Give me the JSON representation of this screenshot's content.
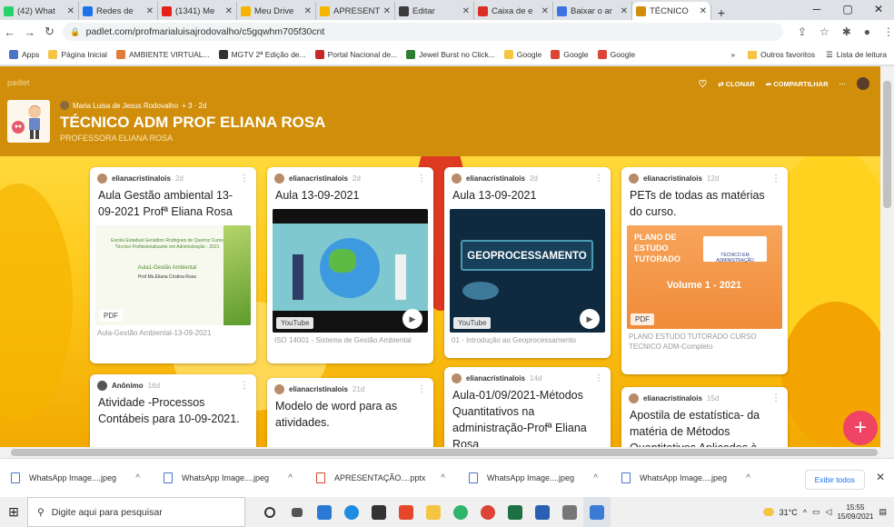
{
  "tabs": [
    {
      "label": "(42) What",
      "color": "#25d366"
    },
    {
      "label": "Redes de",
      "color": "#1a73e8"
    },
    {
      "label": "(1341) Me",
      "color": "#e62117"
    },
    {
      "label": "Meu Drive",
      "color": "#f4b400"
    },
    {
      "label": "APRESENT",
      "color": "#f4b400"
    },
    {
      "label": "Editar",
      "color": "#3c3c3c"
    },
    {
      "label": "Caixa de e",
      "color": "#d93025"
    },
    {
      "label": "Baixar o ar",
      "color": "#3b72e4"
    },
    {
      "label": "TÉCNICO",
      "color": "#d08e0b",
      "active": true
    }
  ],
  "window_controls": {
    "minimize": "─",
    "maximize": "▢",
    "close": "✕"
  },
  "url": "padlet.com/profmarialuisajrodovalho/c5gqwhm705f30cnt",
  "bookmarks": [
    "Apps",
    "Página Inicial",
    "AMBIENTE VIRTUAL...",
    "MGTV 2ª Edição de...",
    "Portal Nacional de...",
    "Jewel Burst no Click...",
    "Google",
    "Google",
    "Google"
  ],
  "bookmarks_right": {
    "more": "»",
    "outros": "Outros favoritos",
    "lista": "Lista de leitura"
  },
  "padlet": {
    "brand": "padlet",
    "author": "Maria Luisa de Jesus Rodovalho",
    "author_meta": "+ 3 · 2d",
    "title": "TÉCNICO ADM PROF ELIANA ROSA",
    "subtitle": "PROFESSORA ELIANA ROSA",
    "clone_label": "CLONAR",
    "share_label": "COMPARTILHAR",
    "more_label": "···",
    "accent": "#d08e0b"
  },
  "cards": [
    {
      "author": "elianacristinalois",
      "ago": "2d",
      "title": "Aula Gestão ambiental 13-09-2021 Profª Eliana Rosa",
      "badge": "PDF",
      "caption": "Aula-Gestão Ambiental-13-09-2021",
      "thumb_line1": "Escola Estadual Geraldino Rodrigues de Queiroz Curso Técnico Profissionalizante em Administração - 2021",
      "thumb_line2": "Aula1-Gestão Ambiental",
      "thumb_line3": "Prof Ms.Eliana Cristina Rosa"
    },
    {
      "author": "elianacristinalois",
      "ago": "2d",
      "title": "Aula 13-09-2021",
      "badge": "YouTube",
      "caption": "ISO 14001 - Sistema de Gestão Ambiental"
    },
    {
      "author": "elianacristinalois",
      "ago": "2d",
      "title": "Aula 13-09-2021",
      "badge": "YouTube",
      "caption": "01 - Introdução ao Geoprocessamento",
      "thumb_text": "GEOPROCESSAMENTO"
    },
    {
      "author": "elianacristinalois",
      "ago": "12d",
      "title": "PETs de todas as matérias do curso.",
      "badge": "PDF",
      "caption": "PLANO ESTUDO TUTORADO CURSO TECNICO ADM-Completo",
      "thumb_line1": "PLANO DE ESTUDO TUTORADO",
      "thumb_line2": "Volume 1 - 2021",
      "thumb_line3": "TÉCNICO EM ADMINISTRAÇÃO"
    },
    {
      "author": "Anônimo",
      "ago": "16d",
      "title": "Atividade -Processos Contábeis para 10-09-2021."
    },
    {
      "author": "elianacristinalois",
      "ago": "21d",
      "title": "Modelo de word para as atividades."
    },
    {
      "author": "elianacristinalois",
      "ago": "14d",
      "title": "Aula-01/09/2021-Métodos Quantitativos na administração-Profª Eliana Rosa"
    },
    {
      "author": "elianacristinalois",
      "ago": "15d",
      "title": "Apostila de estatística- da matéria de Métodos Quantitativos Aplicados à"
    }
  ],
  "fab": "+",
  "downloads": [
    "WhatsApp Image....jpeg",
    "WhatsApp Image....jpeg",
    "APRESENTAÇÃO....pptx",
    "WhatsApp Image....jpeg",
    "WhatsApp Image....jpeg"
  ],
  "downloads_show_all": "Exibir todos",
  "taskbar": {
    "search_placeholder": "Digite aqui para pesquisar",
    "weather": "31°C",
    "time": "15:55",
    "date": "15/09/2021"
  }
}
